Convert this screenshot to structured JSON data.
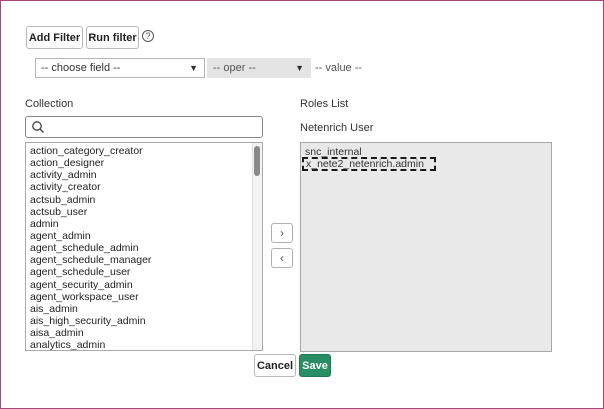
{
  "toolbar": {
    "add_filter_label": "Add Filter",
    "run_filter_label": "Run filter",
    "help_glyph": "?"
  },
  "filter": {
    "field_value": "-- choose field --",
    "oper_value": "-- oper --",
    "value_label": "-- value --"
  },
  "collection": {
    "title": "Collection",
    "search_placeholder": "",
    "items": [
      "action_category_creator",
      "action_designer",
      "activity_admin",
      "activity_creator",
      "actsub_admin",
      "actsub_user",
      "admin",
      "agent_admin",
      "agent_schedule_admin",
      "agent_schedule_manager",
      "agent_schedule_user",
      "agent_security_admin",
      "agent_workspace_user",
      "ais_admin",
      "ais_high_security_admin",
      "aisa_admin",
      "analytics_admin"
    ]
  },
  "roles": {
    "title": "Roles List",
    "subtitle": "Netenrich User",
    "items": [
      "snc_internal",
      "x_nete2_netenrich.admin"
    ]
  },
  "mover": {
    "add_glyph": "›",
    "remove_glyph": "‹"
  },
  "footer": {
    "cancel_label": "Cancel",
    "save_label": "Save"
  },
  "colors": {
    "save_bg": "#278d62",
    "frame_border": "#a8457a",
    "roles_bg": "#e9e9e9"
  }
}
